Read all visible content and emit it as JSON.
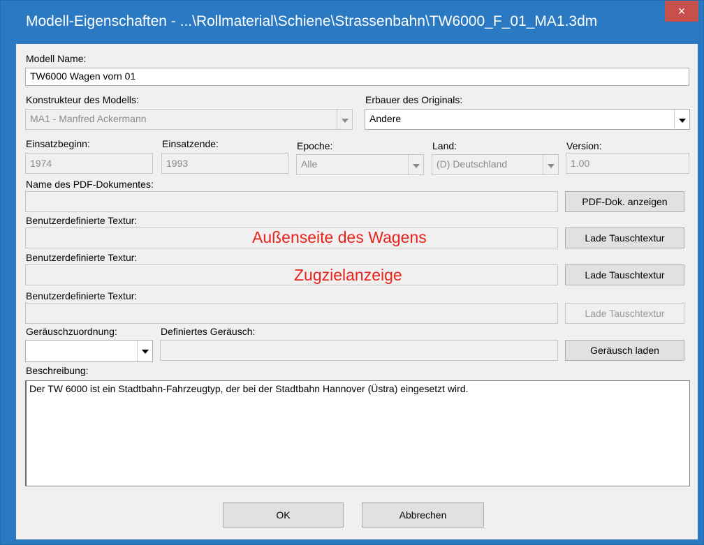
{
  "window": {
    "title": "Modell-Eigenschaften - ...\\Rollmaterial\\Schiene\\Strassenbahn\\TW6000_F_01_MA1.3dm",
    "close_glyph": "×"
  },
  "model_name": {
    "label": "Modell Name:",
    "value": "TW6000 Wagen vorn 01"
  },
  "designer": {
    "label": "Konstrukteur des Modells:",
    "value": "MA1 - Manfred Ackermann"
  },
  "manufacturer": {
    "label": "Erbauer des Originals:",
    "value": "Andere"
  },
  "service_start": {
    "label": "Einsatzbeginn:",
    "value": "1974"
  },
  "service_end": {
    "label": "Einsatzende:",
    "value": "1993"
  },
  "epoch": {
    "label": "Epoche:",
    "value": "Alle"
  },
  "country": {
    "label": "Land:",
    "value": "(D) Deutschland"
  },
  "version": {
    "label": "Version:",
    "value": "1.00"
  },
  "pdf": {
    "label": "Name des PDF-Dokumentes:",
    "value": "",
    "button": "PDF-Dok. anzeigen"
  },
  "textures": [
    {
      "label": "Benutzerdefinierte Textur:",
      "value": "",
      "overlay": "Außenseite des Wagens",
      "button": "Lade Tauschtextur"
    },
    {
      "label": "Benutzerdefinierte Textur:",
      "value": "",
      "overlay": "Zugzielanzeige",
      "button": "Lade Tauschtextur"
    },
    {
      "label": "Benutzerdefinierte Textur:",
      "value": "",
      "overlay": "",
      "button": "Lade Tauschtextur"
    }
  ],
  "sound": {
    "assign_label": "Geräuschzuordnung:",
    "assign_value": "",
    "defined_label": "Definiertes Geräusch:",
    "defined_value": "",
    "button": "Geräusch laden"
  },
  "description": {
    "label": "Beschreibung:",
    "text": "Der TW 6000 ist ein Stadtbahn-Fahrzeugtyp, der bei der Stadtbahn Hannover (Üstra) eingesetzt wird."
  },
  "buttons": {
    "ok": "OK",
    "cancel": "Abbrechen"
  },
  "colors": {
    "titlebar": "#2b79c2",
    "close": "#c7504a",
    "overlay_text": "#e8231b"
  }
}
